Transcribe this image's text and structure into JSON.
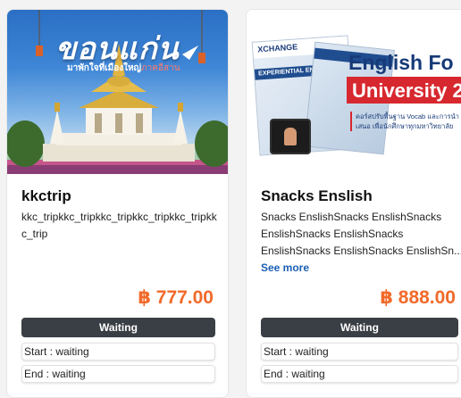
{
  "products": [
    {
      "image_headline": "ขอนแก่น",
      "image_tag_a": "มาพักใจที่เมืองใหญ่",
      "image_tag_b": "ภาคอีสาน",
      "name": "kkctrip",
      "description": "kkc_tripkkc_tripkkc_tripkkc_tripkkc_tripkkc_trip",
      "price": "฿ 777.00",
      "status_label": "Waiting",
      "start_text": "Start : waiting",
      "end_text": "End : waiting"
    },
    {
      "image_title_a": "English Fo",
      "image_title_b": "University 2",
      "image_book_header": "XCHANGE",
      "image_book_bar": "EXPERIENTIAL ENGLISH 2",
      "image_subtitle": "คอร์สปรับพื้นฐาน Vocab และการนำเสนอ เพื่อนักศึกษาทุกมหาวิทยาลัย",
      "name": "Snacks Enslish",
      "description": "Snacks EnslishSnacks EnslishSnacks EnslishSnacks EnslishSnacks EnslishSnacks EnslishSnacks EnslishSn...",
      "see_more": "See more",
      "price": "฿ 888.00",
      "status_label": "Waiting",
      "start_text": "Start : waiting",
      "end_text": "End : waiting"
    }
  ],
  "colors": {
    "price": "#f26a2a",
    "status_button": "#3a3f45",
    "link": "#1a5fb4"
  }
}
